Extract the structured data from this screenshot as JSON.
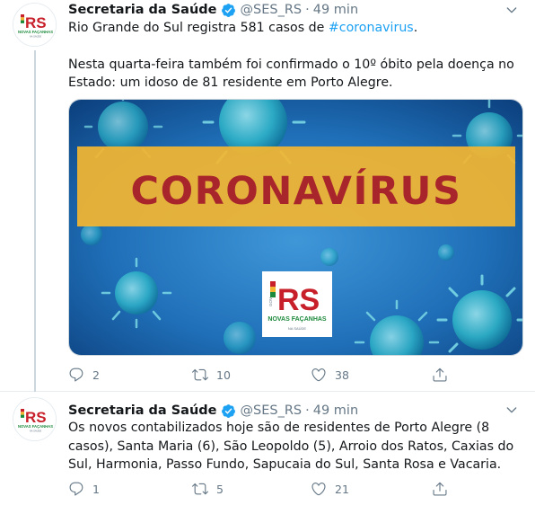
{
  "tweets": [
    {
      "author": "Secretaria da Saúde",
      "handle": "@SES_RS",
      "separator": "·",
      "time": "49 min",
      "text_line1_prefix": "Rio Grande do Sul registra 581 casos de ",
      "hashtag": "#coronavirus",
      "text_line1_suffix": ".",
      "text_para2": "Nesta quarta-feira também foi confirmado o 10º óbito pela doença no Estado: um idoso de 81 residente em Porto Alegre.",
      "media": {
        "banner_text": "CORONAVÍRUS",
        "logo_gov": "GOV",
        "logo_rs": "RS",
        "logo_subtitle": "NOVAS FAÇANHAS",
        "logo_tagline": "NA SAÚDE"
      },
      "replies": "2",
      "retweets": "10",
      "likes": "38"
    },
    {
      "author": "Secretaria da Saúde",
      "handle": "@SES_RS",
      "separator": "·",
      "time": "49 min",
      "text": "Os novos contabilizados hoje são de residentes de Porto Alegre (8 casos), Santa Maria (6), São Leopoldo (5), Arroio dos Ratos, Caxias do Sul, Harmonia, Passo Fundo, Sapucaia do Sul, Santa Rosa e Vacaria.",
      "replies": "1",
      "retweets": "5",
      "likes": "21"
    }
  ],
  "avatar": {
    "gov": "GOV",
    "rs": "RS",
    "subtitle": "NOVAS FAÇANHAS",
    "tagline": "NA SAÚDE"
  },
  "colors": {
    "accent": "#1da1f2",
    "muted": "#657786",
    "banner_yellow": "#f2b632",
    "banner_red": "#a8262b",
    "rs_red": "#c8202a",
    "rs_yellow": "#f2b632",
    "rs_green": "#1c8a3c",
    "media_blue": "#1f6fb8"
  }
}
